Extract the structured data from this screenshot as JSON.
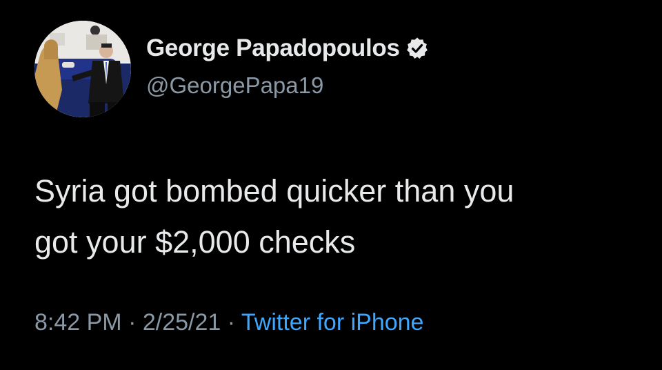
{
  "author": {
    "display_name": "George Papadopoulos",
    "handle": "@GeorgePapa19",
    "verified": true,
    "avatar_icon": "profile-photo"
  },
  "tweet": {
    "text_line1": "Syria got bombed quicker than you",
    "text_line2": "got your $2,000 checks"
  },
  "meta": {
    "time": "8:42 PM",
    "separator": " · ",
    "date": "2/25/21",
    "source": "Twitter for iPhone"
  },
  "colors": {
    "background": "#000000",
    "primary_text": "#e7e9ea",
    "secondary_text": "#8b98a5",
    "link": "#3ea7ff"
  }
}
